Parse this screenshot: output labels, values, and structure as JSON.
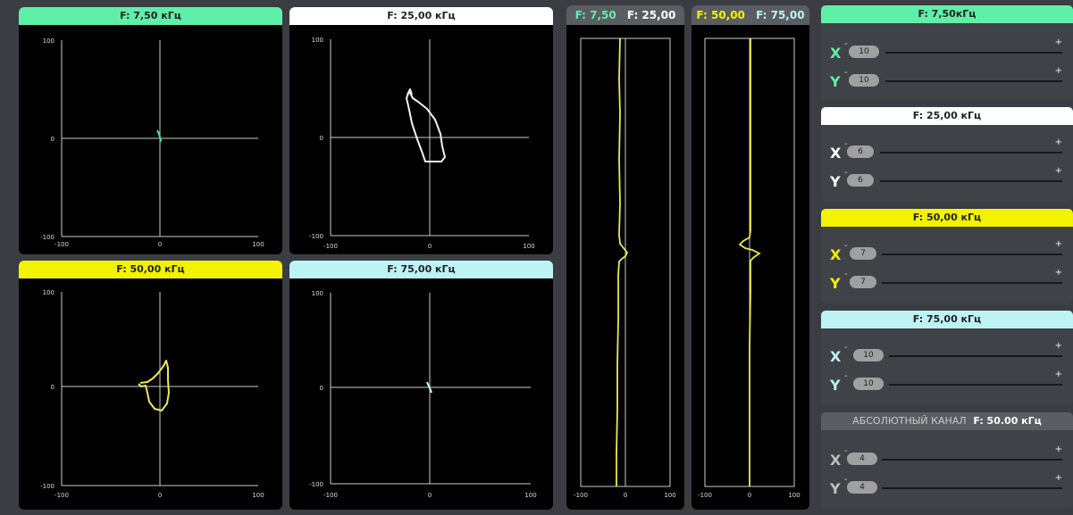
{
  "colors": {
    "green": "#5ef0a8",
    "white": "#ffffff",
    "yellow": "#f3f300",
    "cyan": "#bdf3f5",
    "trace_green": "#46e88f",
    "trace_white": "#f2f2f2",
    "trace_yellow": "#ecea52",
    "trace_cyan": "#c7f5f7"
  },
  "lissajous": [
    {
      "title": "F: 7,50 кГц",
      "ymax": "100",
      "ymid": "0",
      "ymin": "-100",
      "xmin": "-100",
      "xmid": "0",
      "xmax": "100"
    },
    {
      "title": "F: 25,00 кГц",
      "ymax": "100",
      "ymid": "0",
      "ymin": "-100",
      "xmin": "-100",
      "xmid": "0",
      "xmax": "100"
    },
    {
      "title": "F: 50,00 кГц",
      "ymax": "100",
      "ymid": "0",
      "ymin": "-100",
      "xmin": "-100",
      "xmid": "0",
      "xmax": "100"
    },
    {
      "title": "F: 75,00 кГц",
      "ymax": "100",
      "ymid": "0",
      "ymin": "-100",
      "xmin": "-100",
      "xmid": "0",
      "xmax": "100"
    }
  ],
  "strips": [
    {
      "label_a": "F: 7,50",
      "label_b": "F: 25,00",
      "xmin": "-100",
      "xmid": "0",
      "xmax": "100"
    },
    {
      "label_a": "F: 50,00",
      "label_b": "F: 75,00",
      "xmin": "-100",
      "xmid": "0",
      "xmax": "100"
    }
  ],
  "controls": [
    {
      "title": "F: 7,50кГц",
      "x_label": "X",
      "y_label": "Y",
      "x_value": "10",
      "y_value": "10",
      "minus": "-",
      "plus": "+"
    },
    {
      "title": "F: 25,00 кГц",
      "x_label": "X",
      "y_label": "Y",
      "x_value": "6",
      "y_value": "6",
      "minus": "-",
      "plus": "+"
    },
    {
      "title": "F: 50,00 кГц",
      "x_label": "X",
      "y_label": "Y",
      "x_value": "7",
      "y_value": "7",
      "minus": "-",
      "plus": "+"
    },
    {
      "title": "F: 75,00 кГц",
      "x_label": "X",
      "y_label": "Y",
      "x_value": "10",
      "y_value": "10",
      "minus": "-",
      "plus": "+"
    }
  ],
  "absolute": {
    "title": "АБСОЛЮТНЫЙ КАНАЛ",
    "freq": "F: 50.00 кГц",
    "x_label": "X",
    "y_label": "Y",
    "x_value": "4",
    "y_value": "4",
    "minus": "-",
    "plus": "+"
  }
}
